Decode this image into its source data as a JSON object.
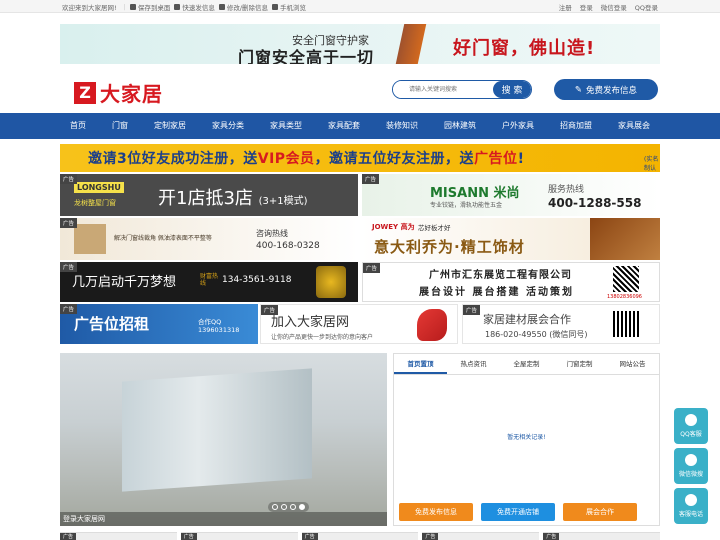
{
  "topbar": {
    "left": [
      "欢迎来到大家居网!",
      "保存到桌面",
      "快速发信息",
      "修改/删除信息",
      "手机浏览"
    ],
    "right": [
      "注册",
      "登录",
      "微信登录",
      "QQ登录"
    ]
  },
  "top_banner": {
    "line1": "安全门窗守护家",
    "line2": "门窗安全高于一切",
    "slogan": "好门窗，佛山造!"
  },
  "logo": {
    "mark": "Z",
    "text": "大家居"
  },
  "search": {
    "placeholder": "请输入关键词搜索",
    "button": "搜 索"
  },
  "publish": "免费发布信息",
  "nav": [
    "首页",
    "门窗",
    "定制家居",
    "家具分类",
    "家具类型",
    "家具配套",
    "装修知识",
    "园林建筑",
    "户外家具",
    "招商加盟",
    "家具展会"
  ],
  "yellow_banner": {
    "part1": "邀请3位好友成功注册，送",
    "vip": "VIP会员",
    "part2": "，邀请五位好友注册，送",
    "ad": "广告位",
    "part3": "!",
    "note": "(实名制认证为准)"
  },
  "ad_tag": "广告",
  "ads": {
    "a1": {
      "brand": "LONGSHU",
      "brand_cn": "龙树整屋门窗",
      "main": "开1店抵3店",
      "sub": "(3+1模式)"
    },
    "a2": {
      "brand": "MISANN 米尚",
      "desc": "专业铰链，滑轨功能性五金",
      "hot": "服务热线",
      "phone": "400-1288-558"
    },
    "a3": {
      "text": "解决门窗线裁角 佩油漆表面不平整等",
      "hot": "咨询热线",
      "phone": "400-168-0328"
    },
    "a4": {
      "brand": "JOWEY 高为",
      "tag": "芯好板才好",
      "main": "意大利乔为·精工饰材"
    },
    "a5": {
      "main": "几万启动千万梦想",
      "label": "财富热线",
      "phone": "134-3561-9118"
    },
    "a6": {
      "title": "广州市汇东展览工程有限公司",
      "sub": "展台设计 展台搭建 活动策划",
      "phone": "13802836096"
    },
    "a7": {
      "main": "广告位招租",
      "qq": "合作QQ",
      "num": "1396031318"
    },
    "a8": {
      "main": "加入大家居网",
      "sub": "让你的产品更快一步到达你的意向客户"
    },
    "a9": {
      "main": "家居建材展会合作",
      "phone": "186-020-49550 (微信同号)"
    }
  },
  "slider": {
    "caption": "登录大家居网",
    "dots": 4,
    "active": 4
  },
  "tabs": [
    "首页置顶",
    "热点资讯",
    "全屋定制",
    "门窗定制",
    "网站公告"
  ],
  "tab_active": 0,
  "empty_text": "暂无相关记录!",
  "action_buttons": [
    "免费发布信息",
    "免费开通店铺",
    "展会合作"
  ],
  "side_float": [
    "QQ客服",
    "微信微搜",
    "客服电话"
  ]
}
